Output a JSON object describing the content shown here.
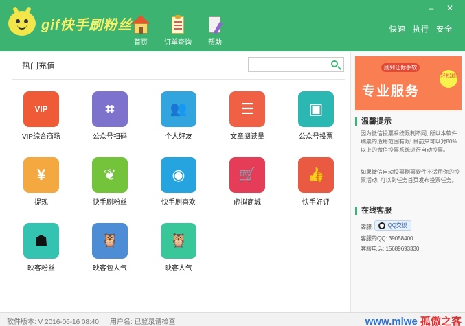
{
  "app": {
    "logo_text": "gif快手刷粉丝"
  },
  "nav": [
    {
      "label": "首页",
      "icon": "home-icon"
    },
    {
      "label": "订单查询",
      "icon": "clipboard-icon"
    },
    {
      "label": "帮助",
      "icon": "help-document-icon"
    }
  ],
  "toolbar": {
    "items": [
      "快速",
      "执行",
      "安全"
    ]
  },
  "window": {
    "minimize": "–",
    "close": "✕"
  },
  "main": {
    "section_title": "热门充值",
    "search": {
      "placeholder": "",
      "icon": "search-icon"
    },
    "tiles": [
      {
        "label": "VIP综合商场",
        "glyph": "VIP",
        "color": "#ef5a37"
      },
      {
        "label": "公众号扫码",
        "glyph": "⌗",
        "color": "#7d73cd"
      },
      {
        "label": "个人好友",
        "glyph": "👥",
        "color": "#32a5df"
      },
      {
        "label": "文章阅读量",
        "glyph": "☰",
        "color": "#ef6044"
      },
      {
        "label": "公众号投票",
        "glyph": "▣",
        "color": "#2bb7b2"
      },
      {
        "label": "提现",
        "glyph": "¥",
        "color": "#f4a940"
      },
      {
        "label": "快手刷粉丝",
        "glyph": "❦",
        "color": "#73c43a"
      },
      {
        "label": "快手刷喜欢",
        "glyph": "◉",
        "color": "#26a4df"
      },
      {
        "label": "虚拟商城",
        "glyph": "🛒",
        "color": "#e53d57"
      },
      {
        "label": "快手好评",
        "glyph": "👍",
        "color": "#ea5a43"
      },
      {
        "label": "映客粉丝",
        "glyph": "☗",
        "color": "#34c3b1"
      },
      {
        "label": "映客包人气",
        "glyph": "🦉",
        "color": "#4d8dd6"
      },
      {
        "label": "映客人气",
        "glyph": "🦉",
        "color": "#39c799"
      }
    ]
  },
  "sidebar": {
    "banner": {
      "sub": "刷到让你手软",
      "main": "专业服务",
      "badge": "轻松刷"
    },
    "tips": {
      "title": "温馨提示",
      "para1": "因为微信投票系统限制不同, 所以本软件刷票的适用范围有限! 目前只可以对80%以上的微信投票系统进行自动投票。",
      "para2": "如果微信自动投票刷票软件不适用你的投票活动, 可以到任务首页发布投票任务。"
    },
    "service": {
      "title": "在线客服",
      "label": "客服:",
      "qq_button": "QQ交谈",
      "qq_line": "客服的QQ: 39058400",
      "phone_line": "客服电话: 15689693330"
    }
  },
  "footer": {
    "version": "软件版本: V 2016-06-16 08:40",
    "user": "用户名: 已登录请检查"
  },
  "watermark": {
    "text": "www.mlwe",
    "text2": "孤傲之客"
  }
}
